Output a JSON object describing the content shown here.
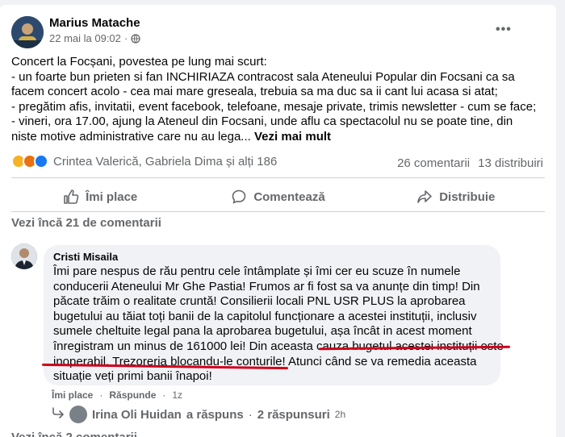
{
  "post": {
    "author": "Marius Matache",
    "date": "22 mai la 09:02",
    "separator": "·",
    "more_label": "•••",
    "text_lines": [
      "Concert la Focșani, povestea pe lung mai scurt:",
      "- un foarte bun prieten si fan INCHIRIAZA contracost sala Ateneului Popular din Focsani ca sa",
      "facem concert acolo - cea mai mare greseala, trebuia sa ma duc sa ii cant lui acasa si atat;",
      "- pregătim afis, invitatii, event facebook, telefoane, mesaje private, trimis newsletter - cum se face;",
      "- vineri, ora 17.00, ajung la Ateneul din Focsani, unde aflu ca spectacolul nu se poate tine, din"
    ],
    "last_line": "niste motive administrative care nu au lega...",
    "see_more": "Vezi mai mult",
    "reactions_text": "Crintea Valerică, Gabriela Dima și alți 186",
    "comments_count": "26 comentarii",
    "shares_count": "13 distribuiri"
  },
  "actions": {
    "like": "Îmi place",
    "comment": "Comentează",
    "share": "Distribuie"
  },
  "view_more_comments": "Vezi încă 21 de comentarii",
  "comment": {
    "author": "Cristi Misaila",
    "text_lines": [
      "Îmi pare nespus de rău pentru cele întâmplate și îmi cer eu scuze în numele",
      "conducerii Ateneului Mr Ghe Pastia! Frumos ar fi fost sa va anunțe din timp! Din",
      "păcate trăim o realitate cruntă! Consilierii locali PNL USR PLUS la aprobarea",
      "bugetului au tăiat toți banii de la capitolul funcționare a acestei instituții, inclusiv",
      "sumele cheltuite legal pana la aprobarea bugetului, așa încât in acest moment",
      "înregistram un minus de 161000 lei! Din aceasta cauza bugetul acestei instituții este",
      "inoperabil, Trezoreria blocandu-le conturile! Atunci când se va remedia aceasta",
      "situație veți primi banii înapoi!"
    ],
    "like_label": "Îmi place",
    "reply_label": "Răspunde",
    "time": "1z",
    "reply_summary": {
      "name": "Irina Oli Huidan",
      "action": "a răspuns",
      "replies": "2 răspunsuri",
      "time": "2h"
    }
  },
  "view_more_comments_2": "Vezi încă 2 comentarii",
  "colors": {
    "brand_blue": "#1877f2",
    "underline_red": "#d0021b",
    "secondary_text": "#65676b"
  }
}
